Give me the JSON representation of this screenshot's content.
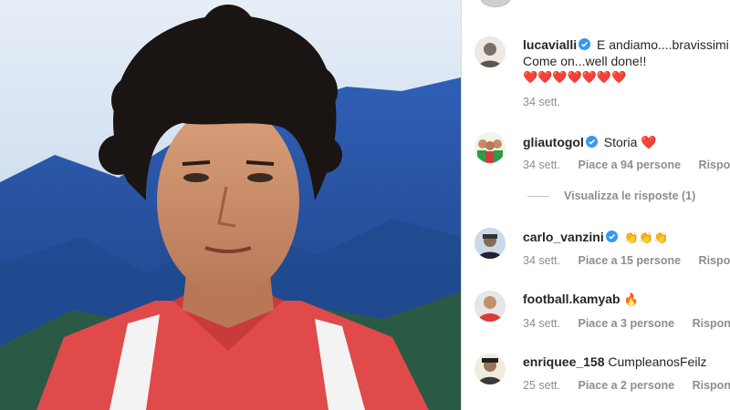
{
  "comments": [
    {
      "username": "lucavialli",
      "verified": true,
      "text": "E andiamo....bravissimi",
      "text2": "Come on...well done!!",
      "hearts": "❤️❤️❤️❤️❤️❤️❤️",
      "time": "34 sett."
    },
    {
      "username": "gliautogol",
      "verified": true,
      "text": "Storia ❤️",
      "time": "34 sett.",
      "likes": "Piace a 94 persone",
      "reply": "Rispondi"
    },
    {
      "username": "carlo_vanzini",
      "verified": true,
      "text": "👏👏👏",
      "time": "34 sett.",
      "likes": "Piace a 15 persone",
      "reply": "Rispondi"
    },
    {
      "username": "football.kamyab",
      "verified": false,
      "text": "🔥",
      "time": "34 sett.",
      "likes": "Piace a 3 persone",
      "reply": "Rispondi"
    },
    {
      "username": "enriquee_158",
      "verified": false,
      "text": "CumpleanosFeilz",
      "time": "25 sett.",
      "likes": "Piace a 2 persone",
      "reply": "Rispondi"
    }
  ],
  "view_replies": "Visualizza le risposte (1)",
  "colors": {
    "verified": "#3897f0",
    "meta": "#8e8e8e",
    "text": "#262626",
    "heart": "#ed4956"
  }
}
